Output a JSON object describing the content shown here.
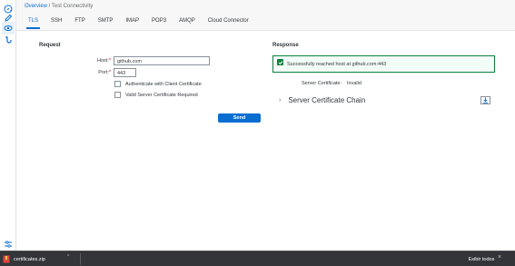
{
  "breadcrumb": {
    "link": "Overview",
    "separator": " / ",
    "current": "Test Connectivity"
  },
  "tabs": [
    {
      "label": "TLS",
      "active": true
    },
    {
      "label": "SSH",
      "active": false
    },
    {
      "label": "FTP",
      "active": false
    },
    {
      "label": "SMTP",
      "active": false
    },
    {
      "label": "IMAP",
      "active": false
    },
    {
      "label": "POP3",
      "active": false
    },
    {
      "label": "AMQP",
      "active": false
    },
    {
      "label": "Cloud Connector",
      "active": false
    }
  ],
  "request": {
    "title": "Request",
    "host_label": "Host:",
    "host_value": "github.com",
    "port_label": "Port:",
    "port_value": "443",
    "required_marker": "*",
    "cb_client_cert": "Authenticate with Client Certificate",
    "cb_server_cert": "Valid Server Certificate Required",
    "send_label": "Send"
  },
  "response": {
    "title": "Response",
    "message": "Successfully reached host at github.com:443",
    "server_cert_label": "Server Certificate:",
    "server_cert_value": "Invalid",
    "chain_label": "Server Certificate Chain"
  },
  "downloads": {
    "file_name": "certificates.zip",
    "show_all": "Exibir todos"
  },
  "colors": {
    "accent": "#0a6ed1",
    "success": "#107e3e",
    "required": "#bb0000",
    "download_bar": "#333539"
  }
}
